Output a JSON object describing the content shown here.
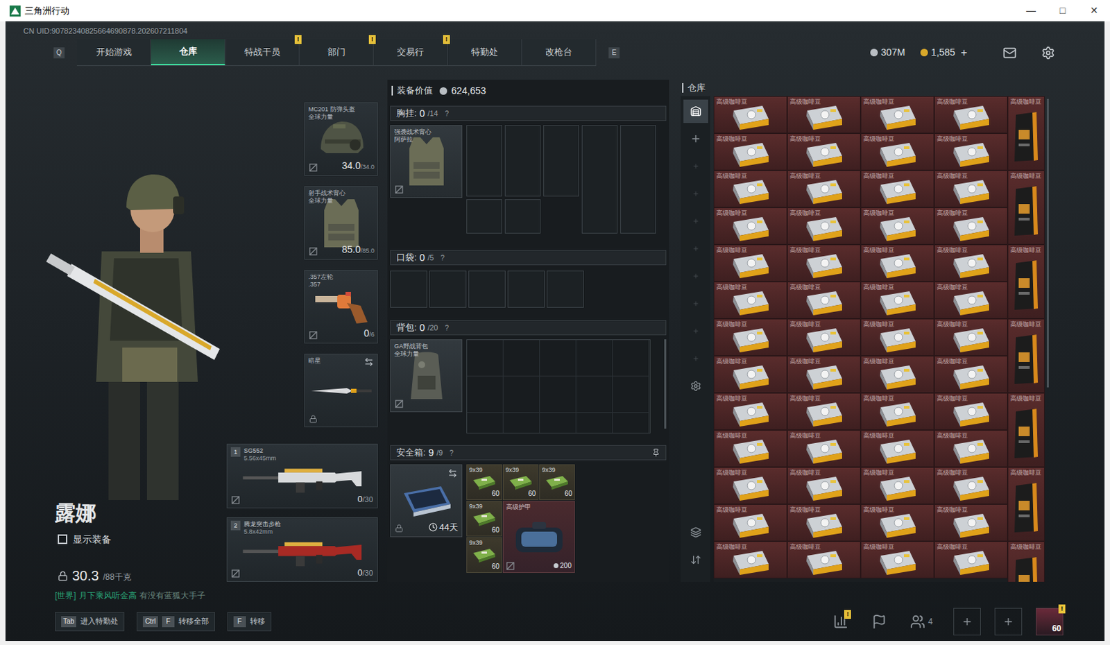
{
  "window": {
    "title": "三角洲行动",
    "controls": [
      "—",
      "□",
      "✕"
    ]
  },
  "uid": "CN UID:90782340825664690878.202607211804",
  "nav": {
    "left_key": "Q",
    "right_key": "E",
    "tabs": [
      {
        "label": "开始游戏",
        "selected": false,
        "badge": ""
      },
      {
        "label": "仓库",
        "selected": true,
        "badge": ""
      },
      {
        "label": "特战干员",
        "selected": false,
        "badge": "!"
      },
      {
        "label": "部门",
        "selected": false,
        "badge": "!"
      },
      {
        "label": "交易行",
        "selected": false,
        "badge": "!"
      },
      {
        "label": "特勤处",
        "selected": false,
        "badge": ""
      },
      {
        "label": "改枪台",
        "selected": false,
        "badge": ""
      }
    ]
  },
  "currency": [
    {
      "kind": "coin",
      "value": "307M",
      "action": ""
    },
    {
      "kind": "gold",
      "value": "1,585",
      "action": "+"
    }
  ],
  "operator": {
    "name": "露娜",
    "show_equipment": {
      "label": "显示装备",
      "checked": false
    },
    "weight": {
      "value": "30.3",
      "max": "/88千克"
    }
  },
  "chat": {
    "channel": "[世界]",
    "sender": "月下乘风听金高",
    "message": "有没有蓝狐大手子"
  },
  "gear": [
    {
      "kind": "helmet",
      "name": "MC201 防弹头盔",
      "maker": "全球力量",
      "reading": "34.0",
      "max": "/34.0"
    },
    {
      "kind": "armor",
      "name": "射手战术背心",
      "maker": "全球力量",
      "reading": "85.0",
      "max": "/85.0"
    },
    {
      "kind": "sidearm",
      "name": ".357左轮",
      "maker": ".357",
      "reading": "0",
      "max": "/6"
    },
    {
      "kind": "melee",
      "name": "暗星",
      "maker": "",
      "reading": "",
      "max": ""
    }
  ],
  "weapons": [
    {
      "index": "1",
      "name": "SG552",
      "caliber": "5.56x45mm",
      "ammo": "0",
      "max": "/30",
      "color": "#d8dadc"
    },
    {
      "index": "2",
      "name": "腾龙突击步枪",
      "caliber": "5.8x42mm",
      "ammo": "0",
      "max": "/30",
      "color": "#a82a24"
    }
  ],
  "loadout": {
    "value_label": "装备价值",
    "value": "624,653",
    "help": "?",
    "chest": {
      "label": "胸挂:",
      "count": "0",
      "capacity": "/14",
      "item": {
        "name": "强袭战术背心",
        "maker": "阿萨拉"
      }
    },
    "pocket": {
      "label": "口袋:",
      "count": "0",
      "capacity": "/5"
    },
    "backpack": {
      "label": "背包:",
      "count": "0",
      "capacity": "/20",
      "item": {
        "name": "GA野战背包",
        "maker": "全球力量"
      }
    },
    "safebox": {
      "label": "安全箱:",
      "count": "9",
      "capacity": "/9",
      "days": "44天",
      "items": [
        {
          "kind": "ammo",
          "name": "9x39",
          "count": "60"
        },
        {
          "kind": "ammo",
          "name": "9x39",
          "count": "60"
        },
        {
          "kind": "ammo",
          "name": "9x39",
          "count": "60"
        },
        {
          "kind": "ammo",
          "name": "9x39",
          "count": "60"
        },
        {
          "kind": "armor",
          "name": "高级护甲",
          "count": "200"
        },
        {
          "kind": "ammo",
          "name": "9x39",
          "count": "60"
        }
      ]
    }
  },
  "warehouse": {
    "title": "仓库",
    "side_buttons": [
      {
        "kind": "warehouse",
        "selected": true
      },
      {
        "kind": "add",
        "selected": false
      },
      {
        "kind": "slot",
        "selected": false
      },
      {
        "kind": "slot",
        "selected": false
      },
      {
        "kind": "slot",
        "selected": false
      },
      {
        "kind": "slot",
        "selected": false
      },
      {
        "kind": "slot",
        "selected": false
      },
      {
        "kind": "slot",
        "selected": false
      },
      {
        "kind": "slot",
        "selected": false
      },
      {
        "kind": "slot",
        "selected": false
      },
      {
        "kind": "settings",
        "selected": false
      },
      {
        "kind": "layers",
        "selected": false
      },
      {
        "kind": "transfer",
        "selected": false
      }
    ],
    "columns": [
      {
        "kind": "small",
        "items": [
          "高级咖啡豆",
          "高级咖啡豆",
          "高级咖啡豆",
          "高级咖啡豆",
          "高级咖啡豆",
          "高级咖啡豆",
          "高级咖啡豆",
          "高级咖啡豆",
          "高级咖啡豆",
          "高级咖啡豆",
          "高级咖啡豆",
          "高级咖啡豆",
          "高级咖啡豆"
        ]
      },
      {
        "kind": "small",
        "items": [
          "高级咖啡豆",
          "高级咖啡豆",
          "高级咖啡豆",
          "高级咖啡豆",
          "高级咖啡豆",
          "高级咖啡豆",
          "高级咖啡豆",
          "高级咖啡豆",
          "高级咖啡豆",
          "高级咖啡豆",
          "高级咖啡豆",
          "高级咖啡豆",
          "高级咖啡豆"
        ]
      },
      {
        "kind": "small",
        "items": [
          "高级咖啡豆",
          "高级咖啡豆",
          "高级咖啡豆",
          "高级咖啡豆",
          "高级咖啡豆",
          "高级咖啡豆",
          "高级咖啡豆",
          "高级咖啡豆",
          "高级咖啡豆",
          "高级咖啡豆",
          "高级咖啡豆",
          "高级咖啡豆",
          "高级咖啡豆"
        ]
      },
      {
        "kind": "small",
        "items": [
          "高级咖啡豆",
          "高级咖啡豆",
          "高级咖啡豆",
          "高级咖啡豆",
          "高级咖啡豆",
          "高级咖啡豆",
          "高级咖啡豆",
          "高级咖啡豆",
          "高级咖啡豆",
          "高级咖啡豆",
          "高级咖啡豆",
          "高级咖啡豆",
          "高级咖啡豆"
        ]
      },
      {
        "kind": "tall",
        "items": [
          "高级咖啡豆",
          "高级咖啡豆",
          "高级咖啡豆",
          "高级咖啡豆",
          "高级咖啡豆",
          "高级咖啡豆",
          "高级咖啡豆"
        ]
      }
    ]
  },
  "hints": [
    {
      "keys": [
        "Tab"
      ],
      "label": "进入特勤处"
    },
    {
      "keys": [
        "Ctrl",
        "F"
      ],
      "label": "转移全部"
    },
    {
      "keys": [
        "F"
      ],
      "label": "转移"
    }
  ],
  "squad": {
    "alerts": "!",
    "members": "4",
    "level": "60"
  }
}
